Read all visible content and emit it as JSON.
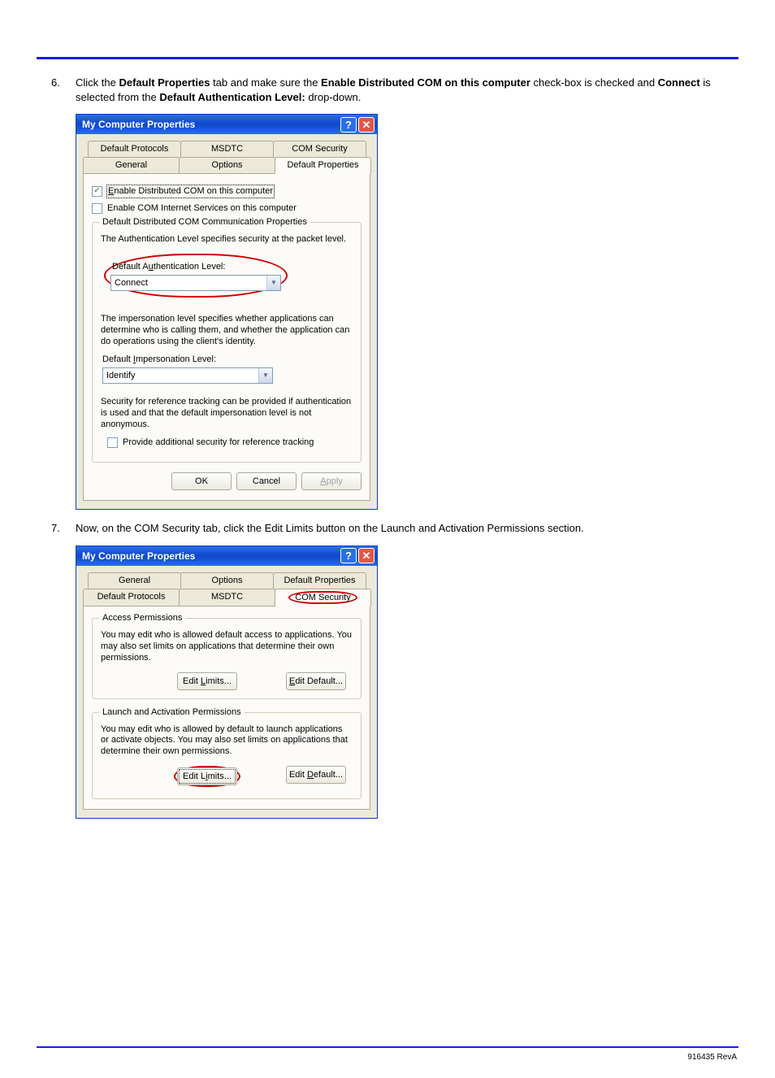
{
  "step6": {
    "number": "6.",
    "text_a": "Click the ",
    "bold_a": "Default Properties",
    "text_b": " tab and make sure the ",
    "bold_b": "Enable Distributed COM on this computer",
    "text_c": " check-box is checked and ",
    "bold_c": "Connect",
    "text_d": " is selected from the ",
    "bold_d": "Default Authentication Level:",
    "text_e": " drop-down."
  },
  "step7": {
    "number": "7.",
    "text": "Now, on the COM Security tab, click the Edit Limits button on the Launch and Activation Permissions section."
  },
  "dialog1": {
    "title": "My Computer Properties",
    "tabs_row1": [
      "Default Protocols",
      "MSDTC",
      "COM Security"
    ],
    "tabs_row2": [
      "General",
      "Options",
      "Default Properties"
    ],
    "check1_label_u": "E",
    "check1_label_rest": "nable Distributed COM on this computer",
    "check2_label": "Enable COM Internet Services on this computer",
    "group_title": "Default Distributed COM Communication Properties",
    "auth_desc": "The Authentication Level specifies security at the packet level.",
    "auth_label": "Default Authentication Level:",
    "auth_value": "Connect",
    "imp_desc": "The impersonation level specifies whether applications can determine who is calling them, and whether the application can do operations using the client's identity.",
    "imp_label": "Default Impersonation Level:",
    "imp_value": "Identify",
    "ref_desc": "Security for reference tracking can be provided if authentication is used and that the default impersonation level is not anonymous.",
    "ref_check_label": "Provide additional security for reference tracking",
    "ok": "OK",
    "cancel": "Cancel",
    "apply": "Apply"
  },
  "dialog2": {
    "title": "My Computer Properties",
    "tabs_row1": [
      "General",
      "Options",
      "Default Properties"
    ],
    "tabs_row2": [
      "Default Protocols",
      "MSDTC",
      "COM Security"
    ],
    "group1_title": "Access Permissions",
    "group1_desc": "You may edit who is allowed default access to applications. You may also set limits on applications that determine their own permissions.",
    "group2_title": "Launch and Activation Permissions",
    "group2_desc": "You may edit who is allowed by default to launch applications or activate objects. You may also set limits on applications that determine their own permissions.",
    "edit_limits": "Edit Limits...",
    "edit_default": "Edit Default..."
  },
  "footer": "916435 RevA"
}
